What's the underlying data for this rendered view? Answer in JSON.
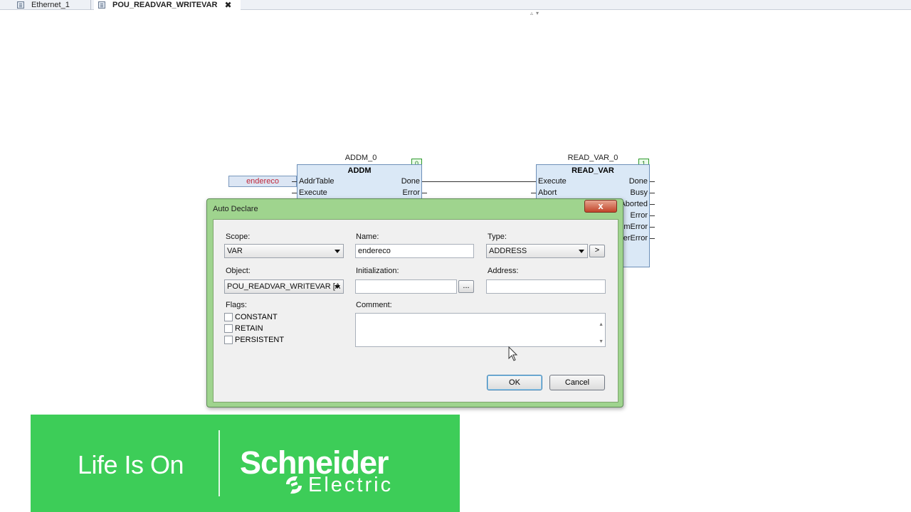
{
  "tabs": [
    {
      "label": "Ethernet_1"
    },
    {
      "label": "POU_READVAR_WRITEVAR",
      "close": "✖"
    }
  ],
  "fbd": {
    "input_variable": "endereco",
    "addm": {
      "instance": "ADDM_0",
      "type": "ADDM",
      "order": "0",
      "inputs": [
        "AddrTable",
        "Execute"
      ],
      "outputs": [
        "Done",
        "Error"
      ]
    },
    "read_var": {
      "instance": "READ_VAR_0",
      "type": "READ_VAR",
      "order": "1",
      "inputs": [
        "Execute",
        "Abort"
      ],
      "outputs": [
        "Done",
        "Busy",
        "Aborted",
        "Error",
        "mError",
        "erError"
      ]
    }
  },
  "dialog": {
    "title": "Auto Declare",
    "close_label": "x",
    "scope_label": "Scope:",
    "scope_value": "VAR",
    "name_label": "Name:",
    "name_value": "endereco",
    "type_label": "Type:",
    "type_value": "ADDRESS",
    "type_button": ">",
    "object_label": "Object:",
    "object_value": "POU_READVAR_WRITEVAR [A",
    "init_label": "Initialization:",
    "init_value": "",
    "init_button": "...",
    "address_label": "Address:",
    "address_value": "",
    "flags_label": "Flags:",
    "flags": [
      {
        "label": "CONSTANT",
        "checked": false
      },
      {
        "label": "RETAIN",
        "checked": false
      },
      {
        "label": "PERSISTENT",
        "checked": false
      }
    ],
    "comment_label": "Comment:",
    "comment_value": "",
    "ok_label": "OK",
    "cancel_label": "Cancel"
  },
  "banner": {
    "tagline": "Life Is On",
    "brand": "Schneider",
    "brand_sub": "Electric",
    "color": "#3dcd58"
  }
}
